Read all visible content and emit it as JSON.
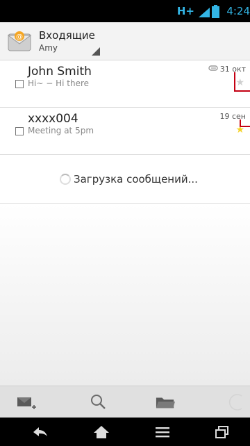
{
  "status_bar": {
    "network": "H+",
    "time": "4:24"
  },
  "header": {
    "folder": "Входящие",
    "account": "Amy"
  },
  "messages": [
    {
      "sender": "John Smith",
      "snippet": "Hi~ − Hi there",
      "date": "31 окт",
      "has_attachment": true,
      "starred": false
    },
    {
      "sender": "xxxx004",
      "snippet": "Meeting at 5pm",
      "date": "19 сен",
      "has_attachment": false,
      "starred": true
    }
  ],
  "loading_text": "Загрузка сообщений...",
  "bottom_actions": [
    "compose-icon",
    "search-icon",
    "folder-icon",
    "refresh-icon"
  ],
  "nav_buttons": [
    "back-icon",
    "home-icon",
    "menu-icon",
    "recent-apps-icon"
  ],
  "colors": {
    "accent": "#33b5e5",
    "annotation_red": "#c40012",
    "star_yellow": "#f5d327"
  }
}
